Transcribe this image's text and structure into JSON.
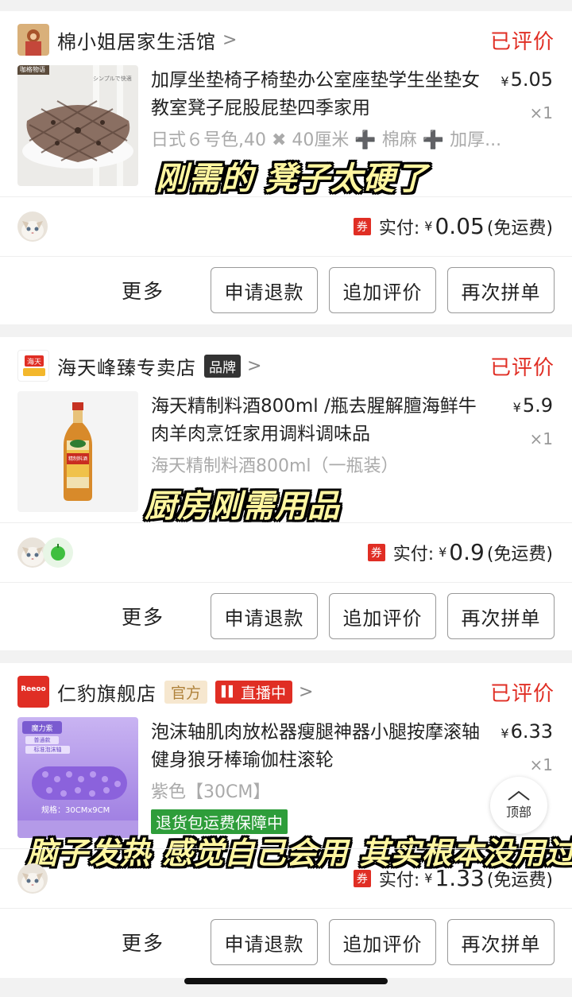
{
  "colors": {
    "accent": "#e02e24",
    "muted": "#999999",
    "caption": "#fff6a0"
  },
  "orders": [
    {
      "shop_name": "棉小姐居家生活馆",
      "status": "已评价",
      "thumb_brand": "咖格物语",
      "thumb_jp": "シンプルで快適",
      "title": "加厚坐垫椅子椅垫办公室座垫学生坐垫女教室凳子屁股屁垫四季家用",
      "price_symbol": "¥",
      "price": "5.05",
      "qty": "×1",
      "sku": "日式６号色,40 ✖ 40厘米 ➕ 棉麻 ➕ 加厚...",
      "caption": "刚需的 凳子太硬了",
      "coupon": "券",
      "paid_label": "实付:",
      "paid_symbol": "¥",
      "paid_amount": "0.05",
      "shipping": "(免运费)",
      "more": "更多",
      "btn_refund": "申请退款",
      "btn_review": "追加评价",
      "btn_rebuy": "再次拼单"
    },
    {
      "shop_name": "海天峰臻专卖店",
      "brand_badge": "品牌",
      "logo_text": "海天",
      "status": "已评价",
      "title": "海天精制料酒800ml /瓶去腥解膻海鲜牛肉羊肉烹饪家用调料调味品",
      "bottle_label": "精制料酒",
      "price_symbol": "¥",
      "price": "5.9",
      "qty": "×1",
      "sku": "海天精制料酒800ml（一瓶装）",
      "caption": "厨房刚需用品",
      "coupon": "券",
      "paid_label": "实付:",
      "paid_symbol": "¥",
      "paid_amount": "0.9",
      "shipping": "(免运费)",
      "more": "更多",
      "btn_refund": "申请退款",
      "btn_review": "追加评价",
      "btn_rebuy": "再次拼单"
    },
    {
      "shop_name": "仁豹旗舰店",
      "official_badge": "官方",
      "live_badge": "直播中",
      "logo_text": "Reeoo",
      "status": "已评价",
      "thumb_tag": "魔力紫",
      "thumb_sub1": "普通款",
      "thumb_sub2": "标准泡沫轴",
      "thumb_spec": "规格：30CMx9CM",
      "title": "泡沫轴肌肉放松器瘦腿神器小腿按摩滚轴健身狼牙棒瑜伽柱滚轮",
      "price_symbol": "¥",
      "price": "6.33",
      "qty": "×1",
      "sku": "紫色【30CM】",
      "guarantee": "退货包运费保障中",
      "caption": "脑子发热 感觉自己会用 其实根本没用过",
      "coupon": "券",
      "paid_label": "实付:",
      "paid_symbol": "¥",
      "paid_amount": "1.33",
      "shipping": "(免运费)",
      "more": "更多",
      "btn_refund": "申请退款",
      "btn_review": "追加评价",
      "btn_rebuy": "再次拼单"
    }
  ],
  "back_to_top": "顶部"
}
